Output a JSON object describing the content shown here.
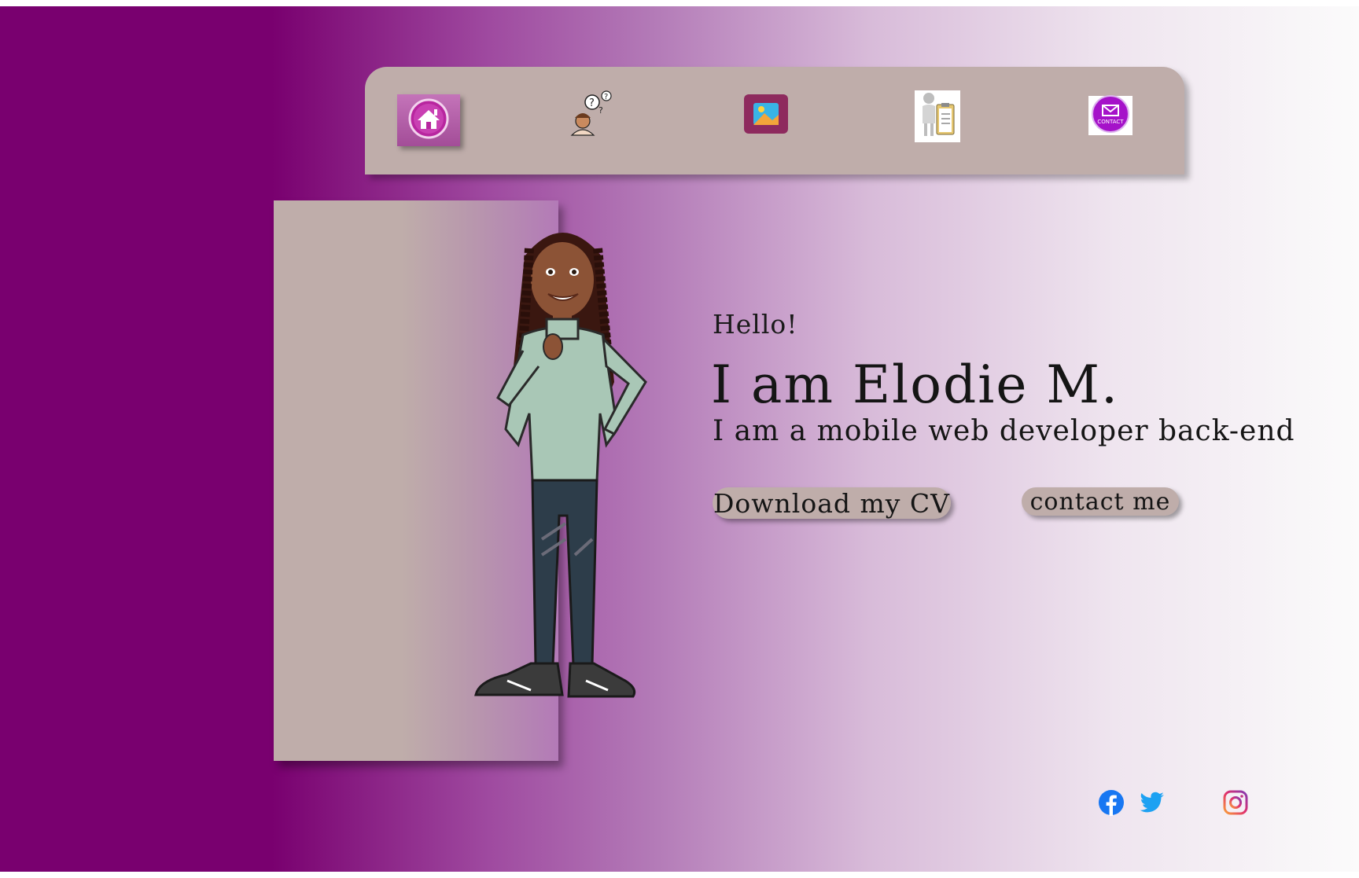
{
  "nav": {
    "items": [
      {
        "id": "home",
        "icon": "home-icon"
      },
      {
        "id": "about",
        "icon": "question-person-icon"
      },
      {
        "id": "gallery",
        "icon": "image-icon"
      },
      {
        "id": "cv",
        "icon": "clipboard-person-icon"
      },
      {
        "id": "contact",
        "icon": "contact-envelope-icon",
        "label": "CONTACT"
      }
    ]
  },
  "hero": {
    "greeting": "Hello!",
    "name": "I am Elodie M.",
    "tagline": "I am a mobile web developer back-end",
    "download_cv_label": "Download my CV",
    "contact_label": "contact me"
  },
  "social": [
    {
      "icon": "facebook-icon"
    },
    {
      "icon": "twitter-icon"
    },
    {
      "icon": "instagram-icon"
    }
  ],
  "colors": {
    "gradient_dark": "#79006f",
    "nav_bg": "#bfadaa",
    "button_bg": "#bfadaa",
    "facebook": "#1877f2",
    "twitter": "#1da1f2"
  }
}
